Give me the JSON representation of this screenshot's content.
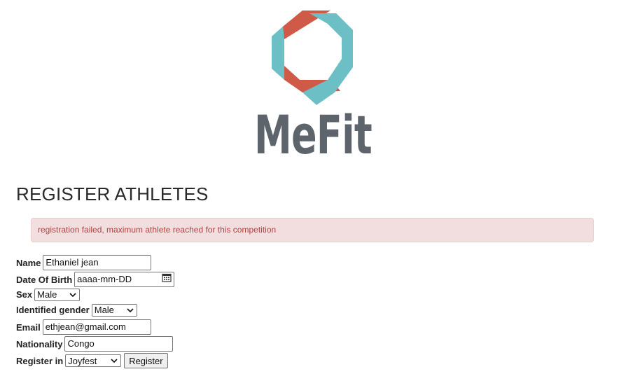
{
  "brand": {
    "logo_text": "MeFit",
    "logo_colors": {
      "red": "#cf5a48",
      "teal": "#6cbfc4",
      "gray": "#5d646b"
    }
  },
  "page": {
    "title": "REGISTER ATHLETES"
  },
  "alert": {
    "message": "registration failed, maximum athlete reached for this competition",
    "background": "#f2dede",
    "text_color": "#a94442"
  },
  "form": {
    "name": {
      "label": "Name",
      "value": "Ethaniel jean"
    },
    "dob": {
      "label": "Date Of Birth",
      "value": "aaaa-mm-DD",
      "icon": "calendar-icon"
    },
    "sex": {
      "label": "Sex",
      "selected": "Male"
    },
    "gender": {
      "label": "Identified gender",
      "selected": "Male"
    },
    "email": {
      "label": "Email",
      "value": "ethjean@gmail.com"
    },
    "nationality": {
      "label": "Nationality",
      "value": "Congo"
    },
    "competition": {
      "label": "Register in",
      "selected": "Joyfest"
    },
    "submit_label": "Register"
  }
}
